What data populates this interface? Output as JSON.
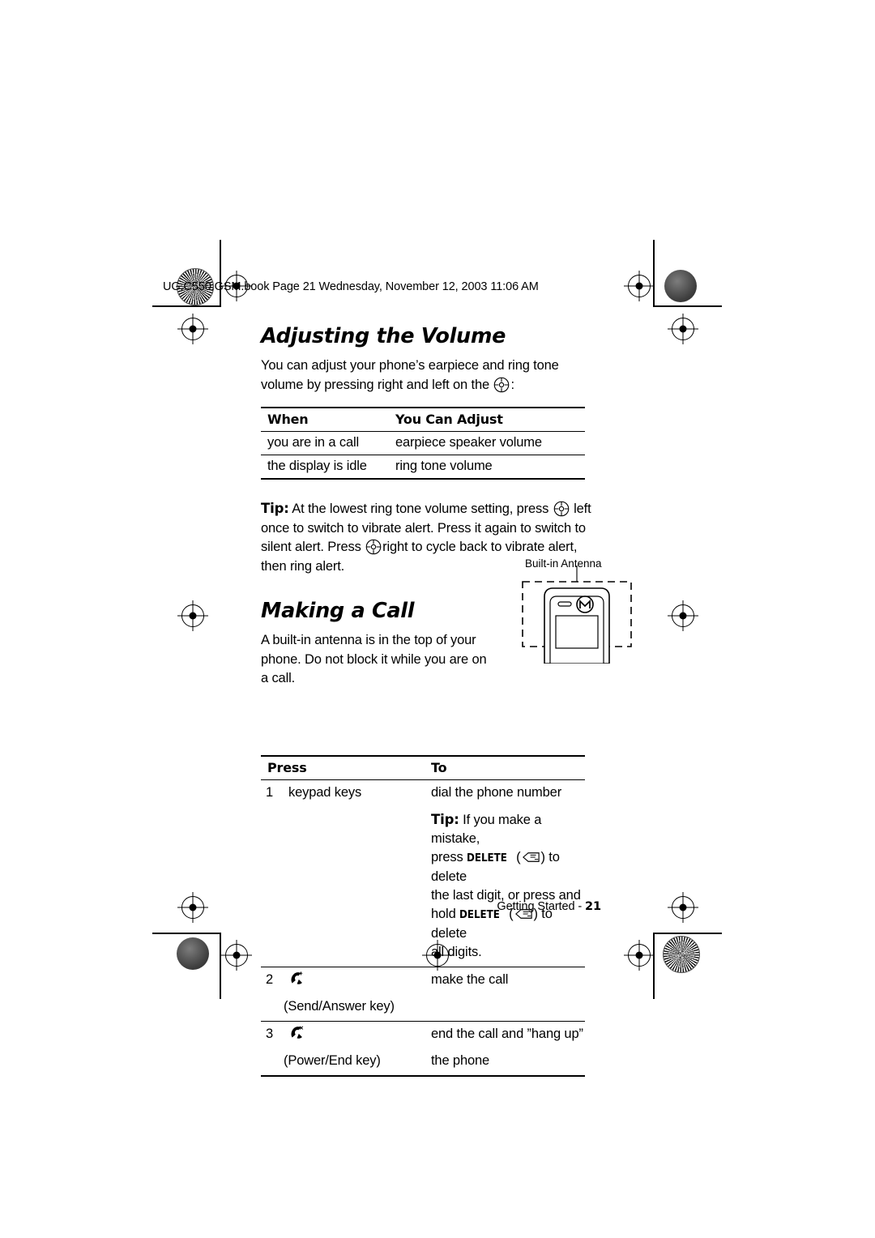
{
  "header": {
    "file_line": "UG.C550.GSM.book  Page 21  Wednesday, November 12, 2003  11:06 AM"
  },
  "sections": [
    {
      "title": "Adjusting the Volume",
      "intro_part1": "You can adjust your phone’s earpiece and ring tone volume by pressing right and left on the",
      "intro_part2": ":",
      "table": {
        "headers": [
          "When",
          "You Can Adjust"
        ],
        "rows": [
          [
            "you are in a call",
            "earpiece speaker volume"
          ],
          [
            "the display is idle",
            "ring tone volume"
          ]
        ]
      },
      "tip_label": "Tip:",
      "tip_text_1": " At the lowest ring tone volume setting, press",
      "tip_text_2": "left once to switch to vibrate alert. Press it again to switch to silent alert. Press",
      "tip_text_3": "right to cycle back to vibrate alert, then ring alert."
    },
    {
      "title": "Making a Call",
      "intro": "A built-in antenna is in the top of your phone. Do not block it while you are on a call.",
      "figure_label": "Built-in Antenna",
      "table": {
        "headers": [
          "Press",
          "To"
        ],
        "rows": [
          {
            "num": "1",
            "press": "keypad keys",
            "press_sub": "",
            "to": "dial the phone number",
            "tip_label": "Tip:",
            "tip_1": " If you make a mistake,",
            "tip_2": "press",
            "tip_delete": "DELETE",
            "tip_3": ") to delete",
            "tip_4": "the last digit, or press and",
            "tip_5": "hold",
            "tip_6": ") to delete",
            "tip_7": "all digits."
          },
          {
            "num": "2",
            "press": "",
            "press_sub": "(Send/Answer key)",
            "to": "make the call"
          },
          {
            "num": "3",
            "press": "",
            "press_sub": "(Power/End key)",
            "to_line1": "end the call and ”hang up”",
            "to_line2": "the phone"
          }
        ]
      }
    }
  ],
  "footer": {
    "text": "Getting Started - ",
    "page": "21"
  }
}
